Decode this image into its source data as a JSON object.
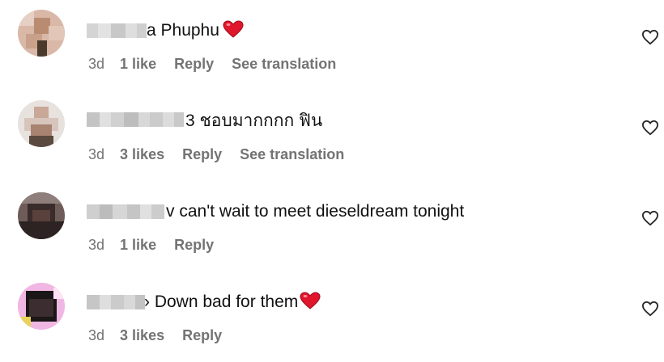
{
  "comments": [
    {
      "text": "a Phuphu",
      "has_heart": true,
      "time": "3d",
      "likes": "1 like",
      "reply": "Reply",
      "translate": "See translation"
    },
    {
      "text": "3 ชอบมากกกก ฟิน",
      "has_heart": false,
      "time": "3d",
      "likes": "3 likes",
      "reply": "Reply",
      "translate": "See translation"
    },
    {
      "text": "v can't wait to meet dieseldream tonight",
      "has_heart": false,
      "time": "3d",
      "likes": "1 like",
      "reply": "Reply",
      "translate": ""
    },
    {
      "text": "› Down bad for them",
      "has_heart": true,
      "time": "3d",
      "likes": "3 likes",
      "reply": "Reply",
      "translate": ""
    }
  ],
  "colors": {
    "heart": "#e0162b",
    "meta_text": "#737373",
    "primary_text": "#111111"
  },
  "icons": {
    "like": "heart-outline-icon",
    "emoji": "red-heart-emoji"
  }
}
